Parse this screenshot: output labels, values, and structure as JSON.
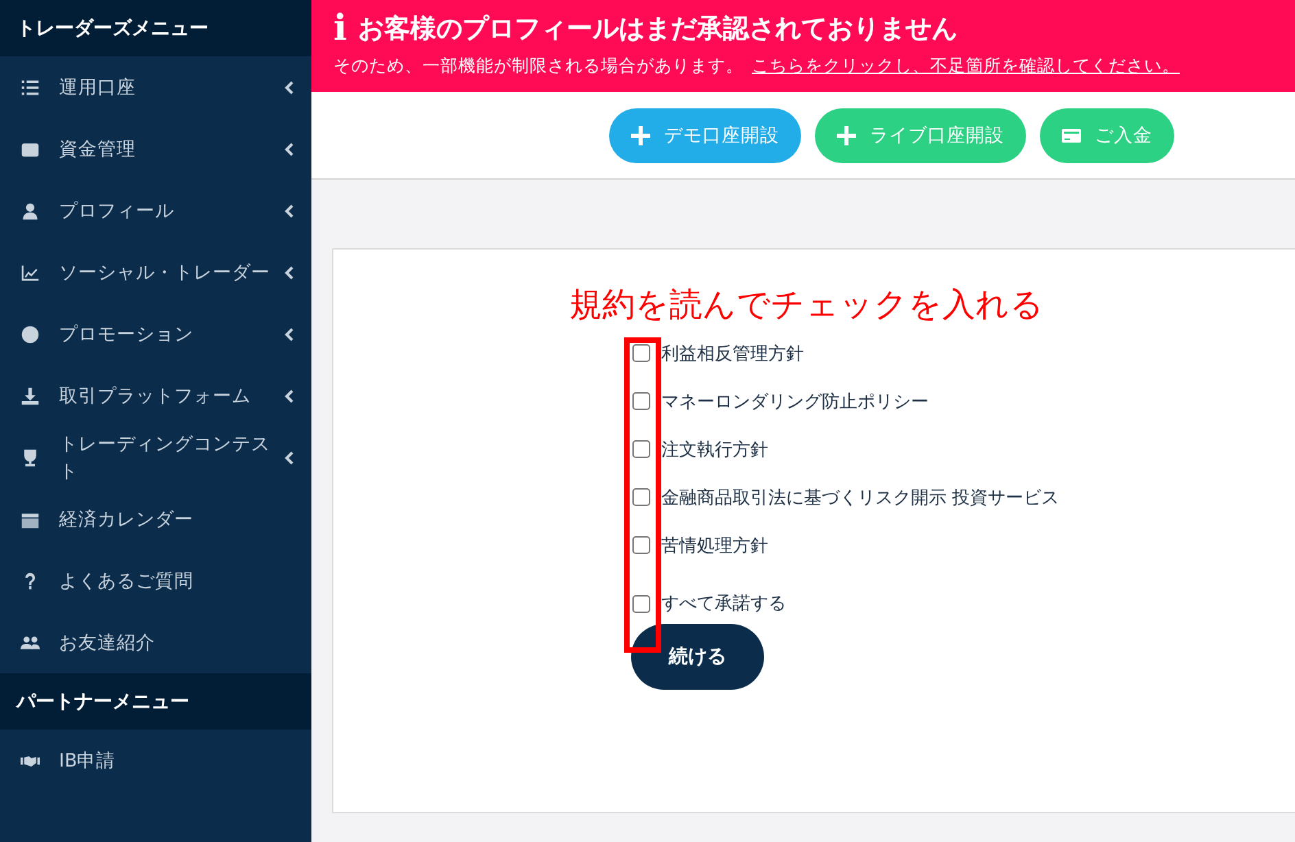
{
  "sidebar": {
    "sections": [
      {
        "title": "トレーダーズメニュー",
        "items": [
          {
            "label": "運用口座",
            "expandable": true
          },
          {
            "label": "資金管理",
            "expandable": true
          },
          {
            "label": "プロフィール",
            "expandable": true
          },
          {
            "label": "ソーシャル・トレーダー",
            "expandable": true
          },
          {
            "label": "プロモーション",
            "expandable": true
          },
          {
            "label": "取引プラットフォーム",
            "expandable": true
          },
          {
            "label": "トレーディングコンテスト",
            "expandable": true
          },
          {
            "label": "経済カレンダー",
            "expandable": false
          },
          {
            "label": "よくあるご質問",
            "expandable": false
          },
          {
            "label": "お友達紹介",
            "expandable": false
          }
        ]
      },
      {
        "title": "パートナーメニュー",
        "items": [
          {
            "label": "IB申請",
            "expandable": false
          }
        ]
      }
    ]
  },
  "alert": {
    "icon": "i",
    "title": "お客様のプロフィールはまだ承認されておりません",
    "message": "そのため、一部機能が制限される場合があります。",
    "link": "こちらをクリックし、不足箇所を確認してください。"
  },
  "actions": [
    {
      "kind": "plus",
      "label": "デモ口座開設",
      "color": "#22ade8"
    },
    {
      "kind": "plus",
      "label": "ライブ口座開設",
      "color": "#2cd184"
    },
    {
      "kind": "card",
      "label": "ご入金",
      "color": "#2cd184"
    }
  ],
  "annotation": {
    "text": "規約を読んでチェックを入れる"
  },
  "agreements": [
    {
      "label": "利益相反管理方針",
      "checked": false
    },
    {
      "label": "マネーロンダリング防止ポリシー",
      "checked": false
    },
    {
      "label": "注文執行方針",
      "checked": false
    },
    {
      "label": "金融商品取引法に基づくリスク開示 投資サービス",
      "checked": false
    },
    {
      "label": "苦情処理方針",
      "checked": false
    }
  ],
  "accept_all": {
    "label": "すべて承諾する",
    "checked": false
  },
  "continue_button": "続ける"
}
